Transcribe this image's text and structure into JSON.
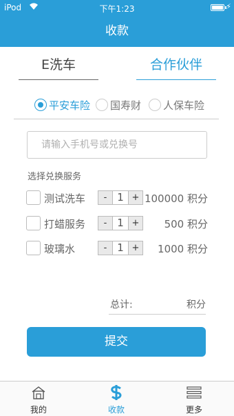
{
  "status_bar": {
    "carrier": "iPod",
    "time": "下午1:23"
  },
  "nav": {
    "title": "收款"
  },
  "tabs": [
    {
      "label": "E洗车"
    },
    {
      "label": "合作伙伴"
    }
  ],
  "insurers": [
    {
      "label": "平安车险",
      "checked": true
    },
    {
      "label": "国寿财",
      "checked": false
    },
    {
      "label": "人保车险",
      "checked": false
    }
  ],
  "phone_input": {
    "placeholder": "请输入手机号或兑换号",
    "value": ""
  },
  "section_title": "选择兑换服务",
  "services": [
    {
      "name": "测试洗车",
      "qty": "1",
      "points": "100000 积分",
      "checked": false
    },
    {
      "name": "打蜡服务",
      "qty": "1",
      "points": "500 积分",
      "checked": false
    },
    {
      "name": "玻璃水",
      "qty": "1",
      "points": "1000 积分",
      "checked": false
    }
  ],
  "stepper": {
    "minus": "-",
    "plus": "+"
  },
  "total": {
    "label": "总计:",
    "unit": "积分"
  },
  "submit_label": "提交",
  "tab_bar": [
    {
      "label": "我的",
      "icon": "home-icon",
      "active": false
    },
    {
      "label": "收款",
      "icon": "dollar-icon",
      "active": true
    },
    {
      "label": "更多",
      "icon": "list-icon",
      "active": false
    }
  ],
  "colors": {
    "accent": "#2a9ed8"
  }
}
